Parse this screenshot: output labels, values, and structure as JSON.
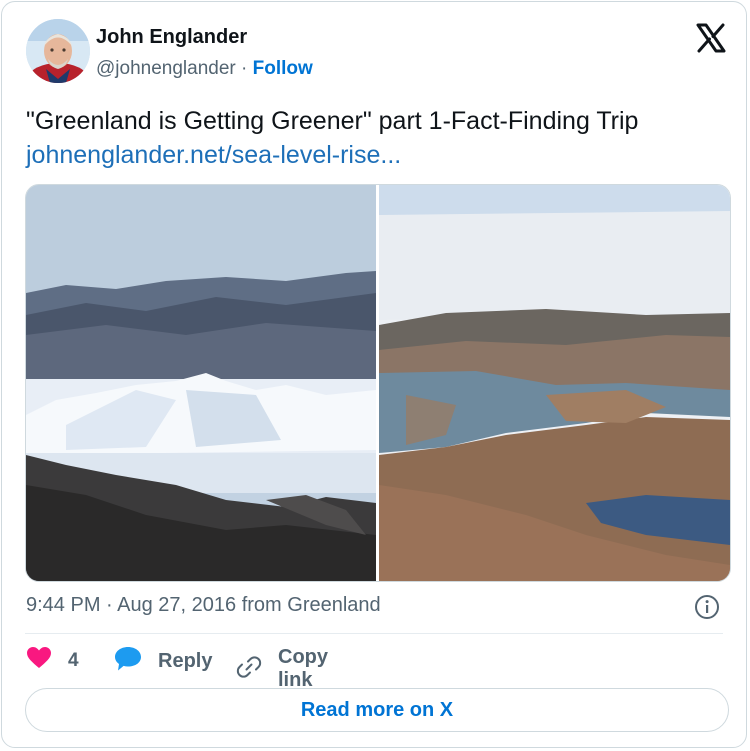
{
  "author": {
    "name": "John Englander",
    "handle": "@johnenglander",
    "separator": " · ",
    "follow_label": "Follow"
  },
  "tweet": {
    "text": "\"Greenland is Getting Greener\" part 1-Fact-Finding Trip",
    "link": "johnenglander.net/sea-level-rise..."
  },
  "meta": {
    "timestamp": "9:44 PM · Aug 27, 2016 from Greenland"
  },
  "actions": {
    "like_count": "4",
    "reply_label": "Reply",
    "copy_label": "Copy link"
  },
  "footer": {
    "read_more_label": "Read more on X"
  },
  "colors": {
    "accent": "#0074d4",
    "like": "#f91880",
    "reply": "#1d9bf0",
    "muted": "#536471"
  },
  "icons": {
    "logo": "x-logo-icon",
    "info": "info-icon",
    "like": "heart-icon",
    "reply": "speech-bubble-icon",
    "copy": "link-icon"
  }
}
